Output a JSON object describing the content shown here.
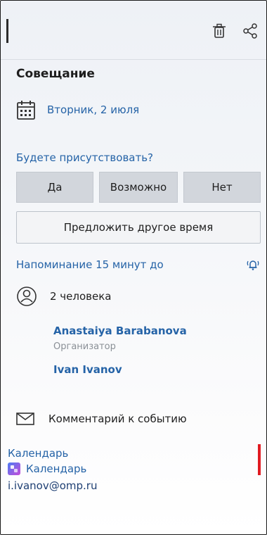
{
  "event": {
    "title": "Совещание",
    "date": "Вторник, 2 июля"
  },
  "rsvp": {
    "question": "Будете присутствовать?",
    "yes_label": "Да",
    "maybe_label": "Возможно",
    "no_label": "Нет",
    "propose_label": "Предложить другое время"
  },
  "reminder": {
    "text": "Напоминание 15 минут до"
  },
  "participants": {
    "count_label": "2 человека",
    "list": [
      {
        "name": "Anastaiya Barabanova",
        "role": "Организатор"
      },
      {
        "name": "Ivan Ivanov",
        "role": ""
      }
    ]
  },
  "comment": {
    "label": "Комментарий к событию"
  },
  "calendar": {
    "section_label": "Календарь",
    "name": "Календарь",
    "email": "i.ivanov@omp.ru"
  },
  "colors": {
    "accent": "#2563a7",
    "indicator": "#e11b22"
  },
  "icons": {
    "toolbar": [
      "trash-icon",
      "share-icon"
    ],
    "date": "calendar-icon",
    "reminder": "bell-ringing-icon",
    "participants": "person-icon",
    "comment": "envelope-icon",
    "calendar_app": "calendar-app-icon"
  }
}
